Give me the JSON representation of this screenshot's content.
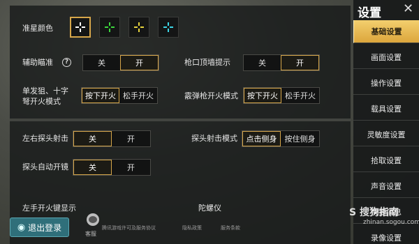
{
  "settings": {
    "crosshair_color_label": "准星颜色",
    "crosshair_colors": [
      "#ffffff",
      "#3cd63c",
      "#e6d23c",
      "#3cd6e6"
    ],
    "aim_assist_label": "辅助瞄准",
    "muzzle_hint_label": "枪口顶墙提示",
    "single_fire_label_line1": "单发狙、十字",
    "single_fire_label_line2": "弩开火模式",
    "shotgun_label": "霰弹枪开火模式",
    "off": "关",
    "on": "开",
    "press_fire": "按下开火",
    "release_fire": "松手开火",
    "peek_fire_label": "左右探头射击",
    "peek_mode_label": "探头射击模式",
    "click_peek": "点击侧身",
    "hold_peek": "按住侧身",
    "auto_scope_label": "探头自动开镜",
    "left_fire_label": "左手开火键显示",
    "gyro_label": "陀螺仪"
  },
  "sidebar": {
    "title": "设置",
    "close": "✕",
    "items": [
      {
        "label": "基础设置"
      },
      {
        "label": "画面设置"
      },
      {
        "label": "操作设置"
      },
      {
        "label": "载具设置"
      },
      {
        "label": "灵敏度设置"
      },
      {
        "label": "拾取设置"
      },
      {
        "label": "声音设置"
      },
      {
        "label": "快捷消息"
      },
      {
        "label": "录像设置"
      }
    ]
  },
  "footer": {
    "exit_label": "退出登录",
    "service_label": "客服",
    "link1": "腾讯游戏许可及服务协议",
    "link2": "隐私政策",
    "link3": "服务条款"
  },
  "watermark": {
    "brand": "S 搜狗指南",
    "url": "zhinan.sogou.com"
  },
  "colors": {
    "accent": "#d6a64a",
    "active_menu": "#f0c862"
  }
}
